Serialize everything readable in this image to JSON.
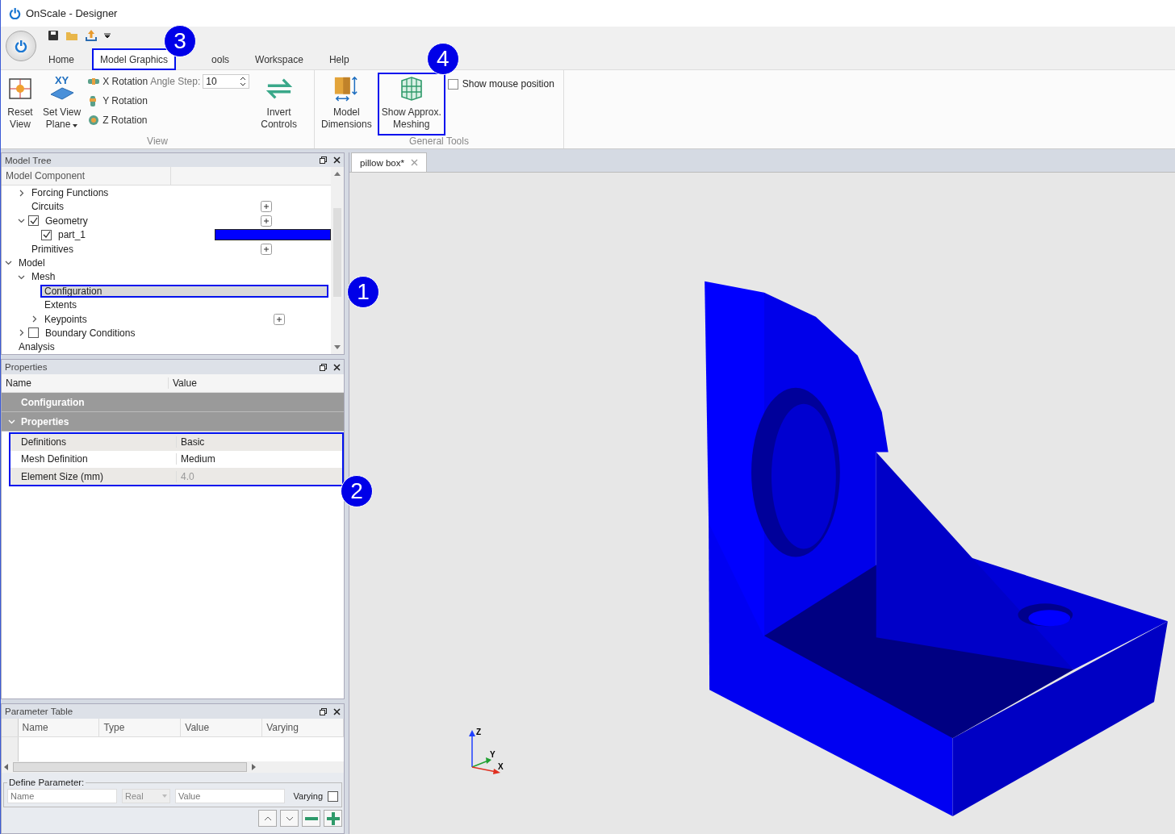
{
  "window": {
    "title": "OnScale - Designer"
  },
  "ribbon": {
    "tabs": [
      {
        "label": "Home",
        "selected": false
      },
      {
        "label": "Model Graphics",
        "selected": true,
        "highlighted": true,
        "callout": "3"
      },
      {
        "label": "ools",
        "selected": false
      },
      {
        "label": "Workspace",
        "selected": false
      },
      {
        "label": "Help",
        "selected": false
      }
    ],
    "groups": [
      {
        "kind": "view",
        "label": "View",
        "buttons": [
          {
            "kind": "reset",
            "label": "Reset\nView"
          },
          {
            "kind": "plane",
            "label": "Set View\nPlane",
            "heading": "XY"
          }
        ],
        "rotations": [
          {
            "kind": "x",
            "label": "X Rotation"
          },
          {
            "kind": "y",
            "label": "Y Rotation"
          },
          {
            "kind": "z",
            "label": "Z Rotation"
          }
        ],
        "angle_step": {
          "label": "Angle Step:",
          "value": "10"
        },
        "extra_buttons": [
          {
            "kind": "invert",
            "label": "Invert\nControls"
          }
        ]
      },
      {
        "kind": "tools",
        "label": "General Tools",
        "buttons": [
          {
            "kind": "dimensions",
            "label": "Model\nDimensions",
            "highlighted": false
          },
          {
            "kind": "mesh",
            "label": "Show Approx.\nMeshing",
            "highlighted": true,
            "callout": "4"
          }
        ],
        "checkbox": {
          "label": "Show mouse position",
          "checked": false
        }
      }
    ]
  },
  "model_tree": {
    "title": "Model Tree",
    "columns": [
      "Model Component"
    ],
    "continued_children": [
      {
        "label": "Forcing Functions",
        "expanded": false,
        "selected": false
      },
      {
        "label": "Circuits",
        "add_button": true,
        "selected": false
      },
      {
        "label": "Geometry",
        "expanded": true,
        "checked": true,
        "add_button": true,
        "selected": false,
        "children": [
          {
            "label": "part_1",
            "checked": true,
            "color": "#0000ff",
            "selected": false
          }
        ]
      },
      {
        "label": "Primitives",
        "add_button": true,
        "selected": false
      }
    ],
    "items": [
      {
        "label": "Model",
        "expanded": true,
        "selected": false,
        "children": [
          {
            "label": "Mesh",
            "expanded": true,
            "selected": false,
            "children": [
              {
                "label": "Configuration",
                "selected": true,
                "highlighted": true,
                "callout": "1"
              },
              {
                "label": "Extents",
                "selected": false
              },
              {
                "label": "Keypoints",
                "expanded": false,
                "add_button": true,
                "selected": false
              }
            ]
          },
          {
            "label": "Boundary Conditions",
            "expanded": false,
            "checked": false,
            "selected": false
          }
        ]
      },
      {
        "label": "Analysis",
        "selected": false
      }
    ]
  },
  "properties": {
    "title": "Properties",
    "columns": [
      "Name",
      "Value"
    ],
    "groups": [
      {
        "label": "Configuration"
      },
      {
        "label": "Properties",
        "expanded": true
      }
    ],
    "highlighted": true,
    "callout": "2",
    "rows": [
      {
        "name": "Definitions",
        "value": "Basic",
        "disabled": false
      },
      {
        "name": "Mesh Definition",
        "value": "Medium",
        "disabled": false
      },
      {
        "name": "Element Size (mm)",
        "value": "4.0",
        "disabled": true
      }
    ]
  },
  "parameter_table": {
    "title": "Parameter Table",
    "columns": [
      "Name",
      "Type",
      "Value",
      "Varying"
    ],
    "define": {
      "label": "Define Parameter:",
      "name": {
        "placeholder": "Name"
      },
      "type": {
        "value": "Real"
      },
      "value": {
        "placeholder": "Value"
      },
      "varying": {
        "label": "Varying",
        "checked": false
      }
    }
  },
  "document_tab": {
    "label": "pillow box*"
  },
  "viewport": {
    "axes": [
      "Z",
      "Y",
      "X"
    ]
  }
}
